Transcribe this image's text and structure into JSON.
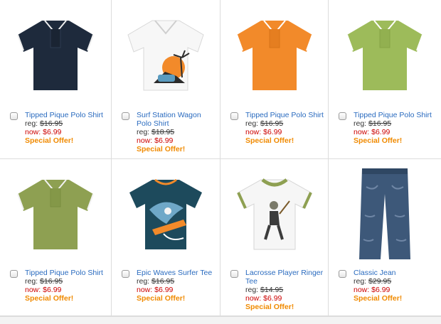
{
  "products": [
    {
      "name": "Tipped Pique Polo Shirt",
      "reg_label": "reg:",
      "reg_price": "$16.95",
      "now_label": "now:",
      "now_price": "$6.99",
      "offer": "Special Offer!",
      "image": "navy-polo-icon",
      "color": "#1e2a3c"
    },
    {
      "name": "Surf Station Wagon Polo Shirt",
      "reg_label": "reg:",
      "reg_price": "$18.95",
      "now_label": "now:",
      "now_price": "$6.99",
      "offer": "Special Offer!",
      "image": "white-surf-polo-icon",
      "color": "#f4f4f4"
    },
    {
      "name": "Tipped Pique Polo Shirt",
      "reg_label": "reg:",
      "reg_price": "$16.95",
      "now_label": "now:",
      "now_price": "$6.99",
      "offer": "Special Offer!",
      "image": "orange-polo-icon",
      "color": "#f28a2a"
    },
    {
      "name": "Tipped Pique Polo Shirt",
      "reg_label": "reg:",
      "reg_price": "$16.95",
      "now_label": "now:",
      "now_price": "$6.99",
      "offer": "Special Offer!",
      "image": "green-polo-icon",
      "color": "#9dbb5a"
    },
    {
      "name": "Tipped Pique Polo Shirt",
      "reg_label": "reg:",
      "reg_price": "$16.95",
      "now_label": "now:",
      "now_price": "$6.99",
      "offer": "Special Offer!",
      "image": "olive-polo-icon",
      "color": "#8ea052"
    },
    {
      "name": "Epic Waves Surfer Tee",
      "reg_label": "reg:",
      "reg_price": "$16.95",
      "now_label": "now:",
      "now_price": "$6.99",
      "offer": "Special Offer!",
      "image": "teal-surfer-tee-icon",
      "color": "#1d4a5c"
    },
    {
      "name": "Lacrosse Player Ringer Tee",
      "reg_label": "reg:",
      "reg_price": "$14.95",
      "now_label": "now:",
      "now_price": "$6.99",
      "offer": "Special Offer!",
      "image": "white-lacrosse-tee-icon",
      "color": "#f6f6f6"
    },
    {
      "name": "Classic Jean",
      "reg_label": "reg:",
      "reg_price": "$29.95",
      "now_label": "now:",
      "now_price": "$6.99",
      "offer": "Special Offer!",
      "image": "denim-jean-icon",
      "color": "#3d5879"
    }
  ]
}
